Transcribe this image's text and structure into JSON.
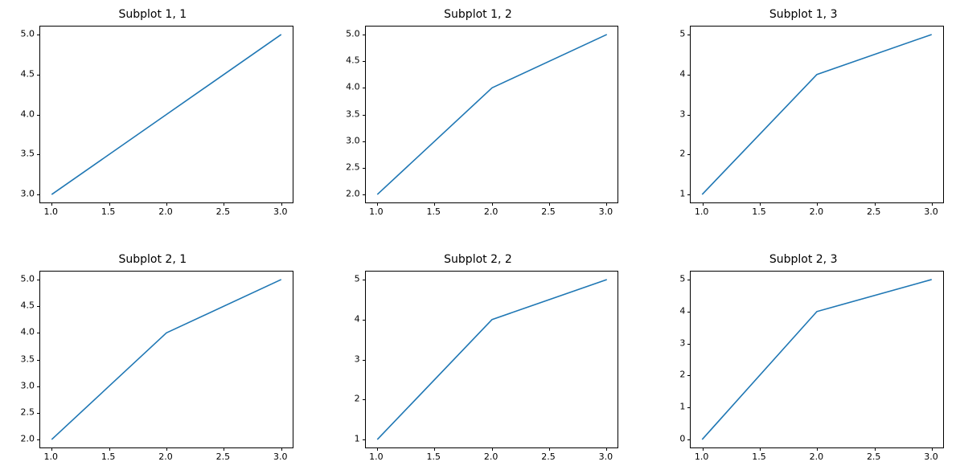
{
  "chart_data": [
    {
      "id": "s11",
      "title": "Subplot 1, 1",
      "type": "line",
      "x": [
        1,
        2,
        3
      ],
      "y": [
        3,
        4,
        5
      ],
      "xticks": [
        1.0,
        1.5,
        2.0,
        2.5,
        3.0
      ],
      "xtick_labels": [
        "1.0",
        "1.5",
        "2.0",
        "2.5",
        "3.0"
      ],
      "yticks": [
        3.0,
        3.5,
        4.0,
        4.5,
        5.0
      ],
      "ytick_labels": [
        "3.0",
        "3.5",
        "4.0",
        "4.5",
        "5.0"
      ],
      "xlim": [
        0.9,
        3.1
      ],
      "ylim": [
        2.9,
        5.1
      ],
      "xlabel": "",
      "ylabel": "",
      "line_color": "#1f77b4"
    },
    {
      "id": "s12",
      "title": "Subplot 1, 2",
      "type": "line",
      "x": [
        1,
        2,
        3
      ],
      "y": [
        2,
        4,
        5
      ],
      "xticks": [
        1.0,
        1.5,
        2.0,
        2.5,
        3.0
      ],
      "xtick_labels": [
        "1.0",
        "1.5",
        "2.0",
        "2.5",
        "3.0"
      ],
      "yticks": [
        2.0,
        2.5,
        3.0,
        3.5,
        4.0,
        4.5,
        5.0
      ],
      "ytick_labels": [
        "2.0",
        "2.5",
        "3.0",
        "3.5",
        "4.0",
        "4.5",
        "5.0"
      ],
      "xlim": [
        0.9,
        3.1
      ],
      "ylim": [
        1.85,
        5.15
      ],
      "xlabel": "",
      "ylabel": "",
      "line_color": "#1f77b4"
    },
    {
      "id": "s13",
      "title": "Subplot 1, 3",
      "type": "line",
      "x": [
        1,
        2,
        3
      ],
      "y": [
        1,
        4,
        5
      ],
      "xticks": [
        1.0,
        1.5,
        2.0,
        2.5,
        3.0
      ],
      "xtick_labels": [
        "1.0",
        "1.5",
        "2.0",
        "2.5",
        "3.0"
      ],
      "yticks": [
        1,
        2,
        3,
        4,
        5
      ],
      "ytick_labels": [
        "1",
        "2",
        "3",
        "4",
        "5"
      ],
      "xlim": [
        0.9,
        3.1
      ],
      "ylim": [
        0.8,
        5.2
      ],
      "xlabel": "",
      "ylabel": "",
      "line_color": "#1f77b4"
    },
    {
      "id": "s21",
      "title": "Subplot 2, 1",
      "type": "line",
      "x": [
        1,
        2,
        3
      ],
      "y": [
        2,
        4,
        5
      ],
      "xticks": [
        1.0,
        1.5,
        2.0,
        2.5,
        3.0
      ],
      "xtick_labels": [
        "1.0",
        "1.5",
        "2.0",
        "2.5",
        "3.0"
      ],
      "yticks": [
        2.0,
        2.5,
        3.0,
        3.5,
        4.0,
        4.5,
        5.0
      ],
      "ytick_labels": [
        "2.0",
        "2.5",
        "3.0",
        "3.5",
        "4.0",
        "4.5",
        "5.0"
      ],
      "xlim": [
        0.9,
        3.1
      ],
      "ylim": [
        1.85,
        5.15
      ],
      "xlabel": "",
      "ylabel": "",
      "line_color": "#1f77b4"
    },
    {
      "id": "s22",
      "title": "Subplot 2, 2",
      "type": "line",
      "x": [
        1,
        2,
        3
      ],
      "y": [
        1,
        4,
        5
      ],
      "xticks": [
        1.0,
        1.5,
        2.0,
        2.5,
        3.0
      ],
      "xtick_labels": [
        "1.0",
        "1.5",
        "2.0",
        "2.5",
        "3.0"
      ],
      "yticks": [
        1,
        2,
        3,
        4,
        5
      ],
      "ytick_labels": [
        "1",
        "2",
        "3",
        "4",
        "5"
      ],
      "xlim": [
        0.9,
        3.1
      ],
      "ylim": [
        0.8,
        5.2
      ],
      "xlabel": "",
      "ylabel": "",
      "line_color": "#1f77b4"
    },
    {
      "id": "s23",
      "title": "Subplot 2, 3",
      "type": "line",
      "x": [
        1,
        2,
        3
      ],
      "y": [
        0,
        4,
        5
      ],
      "xticks": [
        1.0,
        1.5,
        2.0,
        2.5,
        3.0
      ],
      "xtick_labels": [
        "1.0",
        "1.5",
        "2.0",
        "2.5",
        "3.0"
      ],
      "yticks": [
        0,
        1,
        2,
        3,
        4,
        5
      ],
      "ytick_labels": [
        "0",
        "1",
        "2",
        "3",
        "4",
        "5"
      ],
      "xlim": [
        0.9,
        3.1
      ],
      "ylim": [
        -0.25,
        5.25
      ],
      "xlabel": "",
      "ylabel": "",
      "line_color": "#1f77b4"
    }
  ]
}
